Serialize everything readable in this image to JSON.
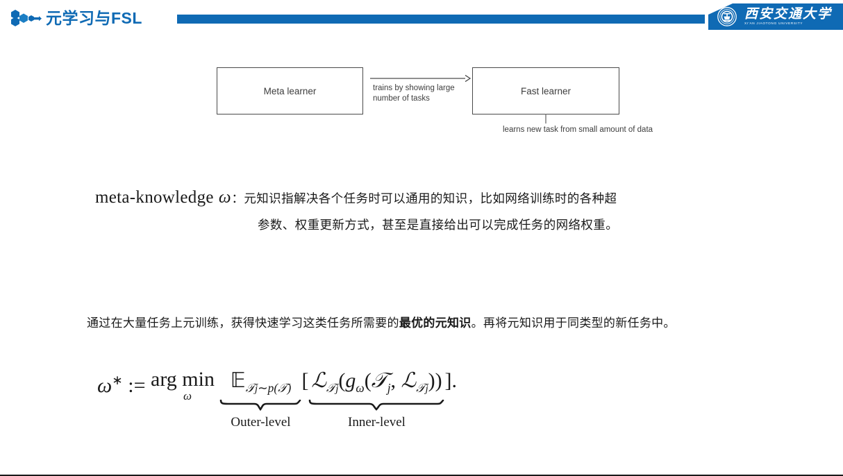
{
  "header": {
    "logo_icon": "hexagon-node-logo",
    "title": "元学习与FSL",
    "accent_color": "#0f6ab4",
    "university": {
      "crest_icon": "xjtu-crest-icon",
      "name_cn": "西安交通大学",
      "name_en": "XI'AN JIAOTONG UNIVERSITY"
    }
  },
  "diagram": {
    "meta_learner_label": "Meta learner",
    "fast_learner_label": "Fast learner",
    "arrow_icon": "right-arrow-icon",
    "edge_label": "trains by showing large number of tasks",
    "tick_icon": "vertical-tick-icon",
    "below_label": "learns new task from small amount of data"
  },
  "meta_knowledge": {
    "term": "meta-knowledge",
    "symbol": "ω",
    "colon": "：",
    "line1_cn": "元知识指解决各个任务时可以通用的知识，比如网络训练时的各种超",
    "line2_cn": "参数、权重更新方式，甚至是直接给出可以完成任务的网络权重。"
  },
  "paragraph": {
    "part1": "通过在大量任务上元训练，获得快速学习这类任务所需要的",
    "bold": "最优的元知识",
    "part2": "。再将元知识用于同类型的新任务中。"
  },
  "formula": {
    "lhs_symbol": "ω",
    "lhs_star": "∗",
    "assign": ":=",
    "argmin_word": "arg min",
    "argmin_sub": "ω",
    "expectation_symbol": "𝔼",
    "expectation_sub": "𝒯",
    "expectation_sub_index": "j",
    "expectation_tilde": "∼",
    "expectation_dist": "p(𝒯)",
    "bracket_open": "[",
    "loss_symbol": "ℒ",
    "loss_sub": "𝒯",
    "loss_sub_index": "j",
    "paren_open": "(",
    "g_symbol": "g",
    "g_sub": "ω",
    "inner_args": "𝒯",
    "inner_args_index": "j",
    "comma": ",",
    "inner_loss": "ℒ",
    "inner_loss_sub": "𝒯",
    "inner_loss_sub_index": "j",
    "paren_close": ")",
    "paren_close2": ")",
    "bracket_close": "]",
    "period": ".",
    "outer_label": "Outer-level",
    "inner_label": "Inner-level"
  }
}
